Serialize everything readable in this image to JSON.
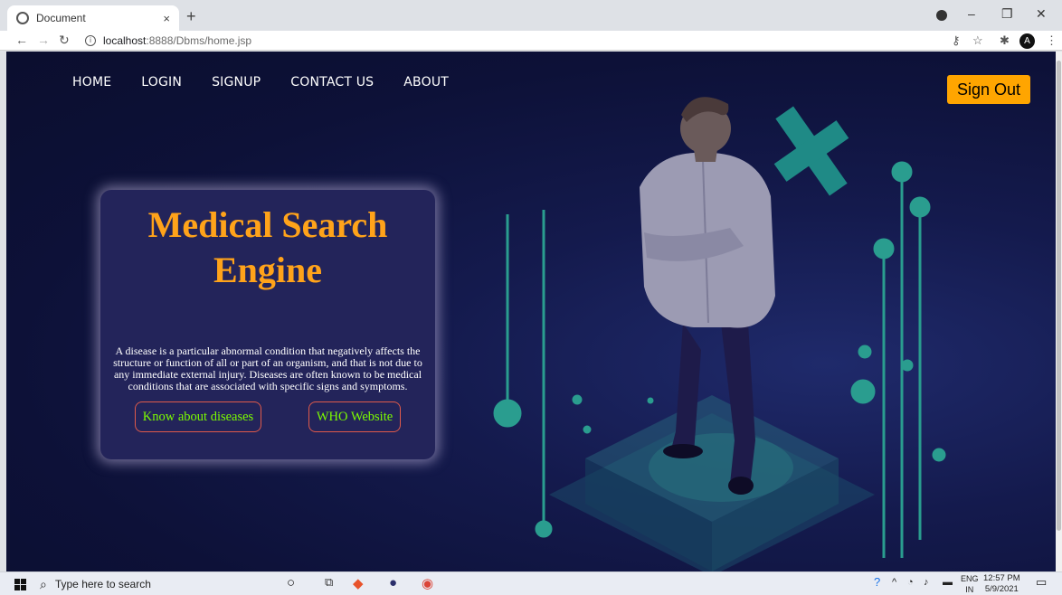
{
  "browser": {
    "tab_title": "Document",
    "tab_close": "×",
    "new_tab": "+",
    "url_host": "localhost",
    "url_path": ":8888/Dbms/home.jsp",
    "info_icon": "ⓘ"
  },
  "nav": {
    "items": [
      "HOME",
      "LOGIN",
      "SIGNUP",
      "CONTACT US",
      "ABOUT"
    ]
  },
  "header": {
    "sign_out_label": "Sign Out"
  },
  "hero": {
    "title": "Medical Search Engine",
    "description": "A disease is a particular abnormal condition that negatively affects the structure or function of all or part of an organism, and that is not due to any immediate external injury. Diseases are often known to be medical conditions that are associated with specific signs and symptoms.",
    "button_diseases": "Know about diseases",
    "button_who": "WHO Website"
  },
  "taskbar": {
    "search_placeholder": "Type here to search",
    "lang_top": "ENG",
    "lang_bottom": "IN",
    "time": "12:57 PM",
    "date": "5/9/2021"
  },
  "colors": {
    "accent_orange": "#ffa500",
    "title_orange": "#ffa31a",
    "button_text_green": "#7cfc00",
    "page_bg": "#0d1138",
    "teal": "#2a9d8f"
  }
}
